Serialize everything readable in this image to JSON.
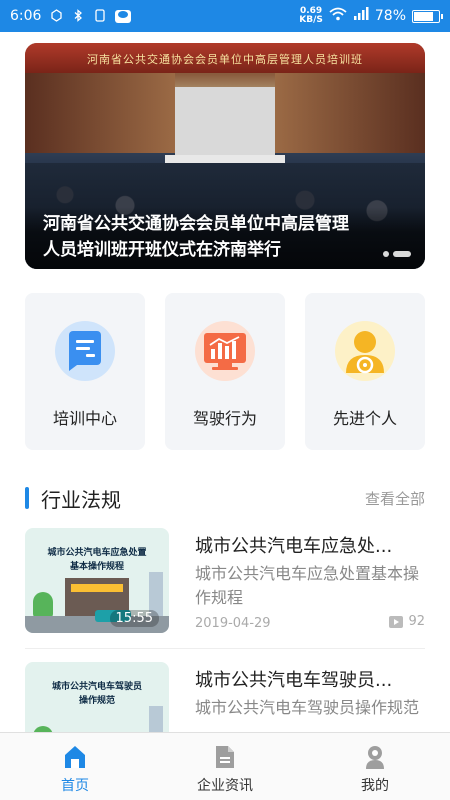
{
  "status_bar": {
    "time": "6:06",
    "net_speed_value": "0.69",
    "net_speed_unit": "KB/S",
    "battery": "78%",
    "battery_level": 0.78,
    "icons": [
      "screenshot-icon",
      "bluetooth-icon",
      "sim-icon",
      "wechat-icon",
      "wifi-icon",
      "signal-icon",
      "battery-icon"
    ]
  },
  "banner": {
    "caption": "河南省公共交通协会会员单位中高层管理人员培训班开班仪式在济南举行",
    "stage_text": "河南省公共交通协会会员单位中高层管理人员培训班",
    "slides": 2,
    "active_slide": 2
  },
  "categories": [
    {
      "label": "培训中心",
      "icon": "training-document-icon",
      "color": "#3a8ff0"
    },
    {
      "label": "驾驶行为",
      "icon": "driving-chart-icon",
      "color": "#f46b45"
    },
    {
      "label": "先进个人",
      "icon": "driver-person-icon",
      "color": "#f5b524"
    }
  ],
  "section": {
    "title": "行业法规",
    "more": "查看全部"
  },
  "articles": [
    {
      "title": "城市公共汽电车应急处...",
      "summary": "城市公共汽电车应急处置基本操作规程",
      "thumb_title": "城市公共汽电车应急处置\n基本操作规程",
      "duration": "15:55",
      "date": "2019-04-29",
      "views": "92"
    },
    {
      "title": "城市公共汽电车驾驶员...",
      "summary": "城市公共汽电车驾驶员操作规范",
      "thumb_title": "城市公共汽电车驾驶员\n操作规范"
    }
  ],
  "bottom_nav": [
    {
      "label": "首页",
      "icon": "home-icon",
      "active": true
    },
    {
      "label": "企业资讯",
      "icon": "document-icon",
      "active": false
    },
    {
      "label": "我的",
      "icon": "user-icon",
      "active": false
    }
  ],
  "colors": {
    "primary": "#1e88e5",
    "text": "#222222",
    "muted": "#888888"
  }
}
